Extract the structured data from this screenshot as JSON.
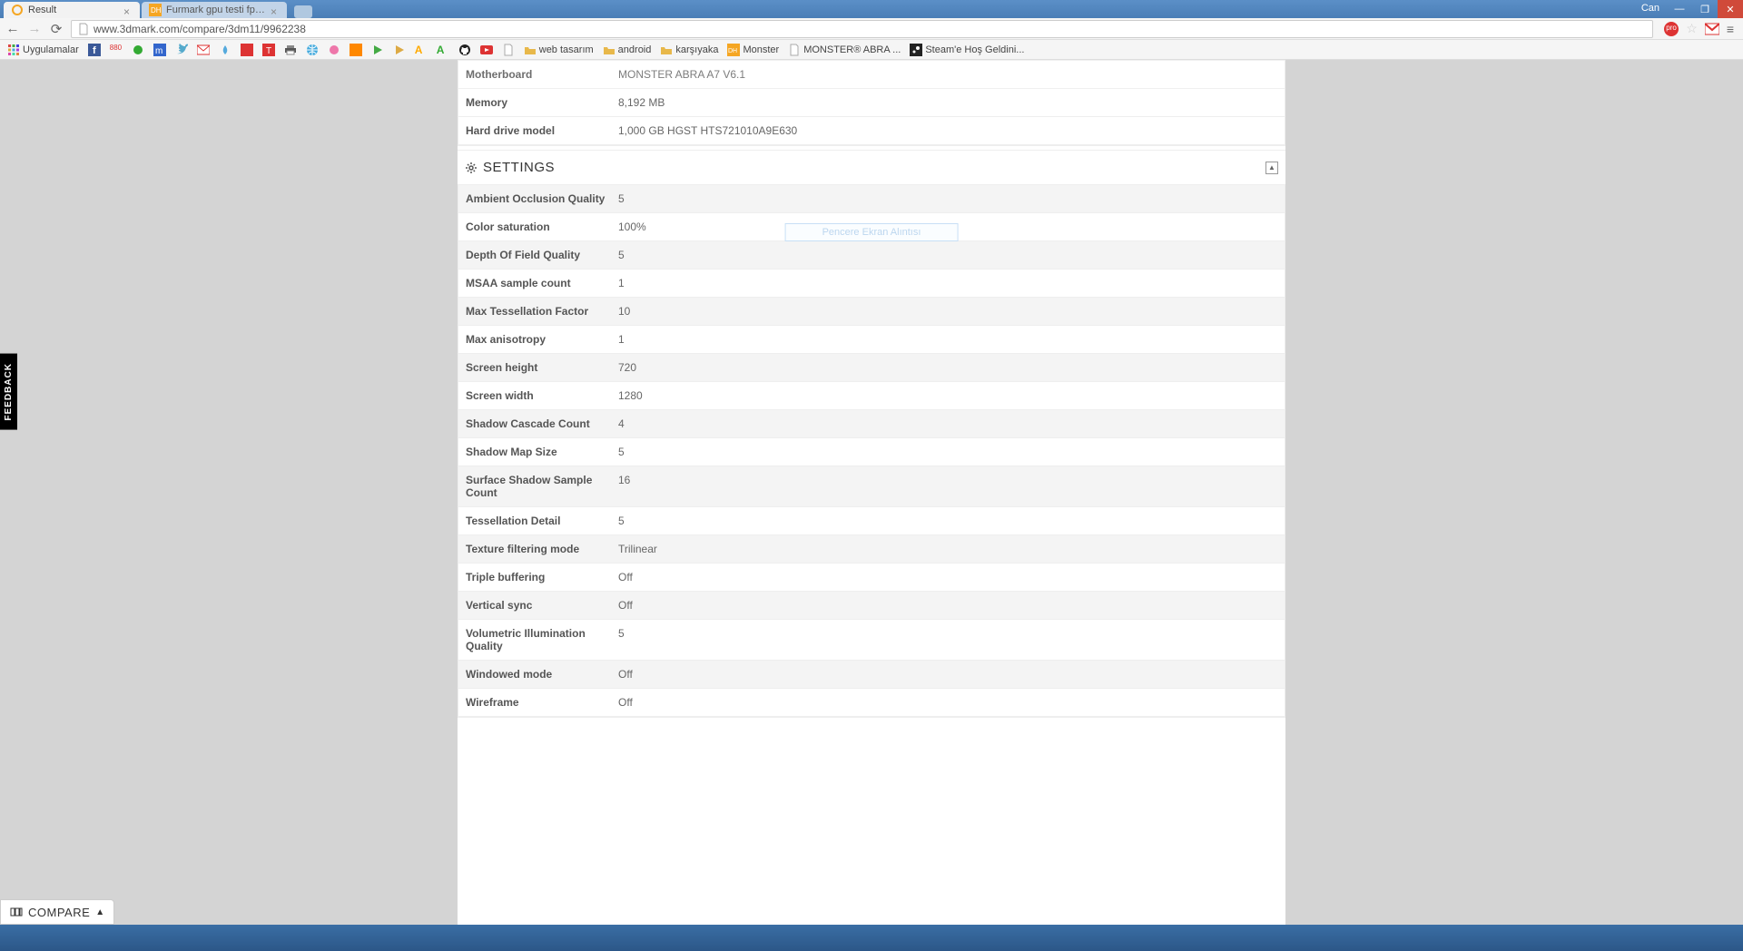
{
  "window": {
    "user": "Can"
  },
  "tabs": [
    {
      "title": "Result",
      "favicon": "orange-circle"
    },
    {
      "title": "Furmark gpu testi fps çok",
      "favicon": "dh-orange"
    }
  ],
  "url": "www.3dmark.com/compare/3dm11/9962238",
  "bookmarks": [
    {
      "label": "Uygulamalar",
      "icon": "apps"
    },
    {
      "label": "",
      "icon": "fb"
    },
    {
      "label": "",
      "icon": "880"
    },
    {
      "label": "",
      "icon": "green-o"
    },
    {
      "label": "",
      "icon": "m-blue"
    },
    {
      "label": "",
      "icon": "twitter"
    },
    {
      "label": "",
      "icon": "gmail"
    },
    {
      "label": "",
      "icon": "blue-drop"
    },
    {
      "label": "",
      "icon": "red-sq"
    },
    {
      "label": "",
      "icon": "red-t"
    },
    {
      "label": "",
      "icon": "print"
    },
    {
      "label": "",
      "icon": "globe"
    },
    {
      "label": "",
      "icon": "pink"
    },
    {
      "label": "",
      "icon": "orange-cal"
    },
    {
      "label": "",
      "icon": "play"
    },
    {
      "label": "",
      "icon": "play-gold"
    },
    {
      "label": "",
      "icon": "a-yellow"
    },
    {
      "label": "",
      "icon": "a-green"
    },
    {
      "label": "",
      "icon": "github"
    },
    {
      "label": "",
      "icon": "youtube"
    },
    {
      "label": "",
      "icon": "file"
    },
    {
      "label": "web tasarım",
      "icon": "folder"
    },
    {
      "label": "android",
      "icon": "folder"
    },
    {
      "label": "karşıyaka",
      "icon": "folder"
    },
    {
      "label": "Monster",
      "icon": "dh"
    },
    {
      "label": "MONSTER® ABRA ...",
      "icon": "file"
    },
    {
      "label": "Steam'e Hoş Geldini...",
      "icon": "steam"
    }
  ],
  "hardware": [
    {
      "label": "Motherboard",
      "value": "MONSTER ABRA A7 V6.1"
    },
    {
      "label": "Memory",
      "value": "8,192 MB"
    },
    {
      "label": "Hard drive model",
      "value": "1,000 GB HGST HTS721010A9E630"
    }
  ],
  "section_title": "SETTINGS",
  "settings": [
    {
      "label": "Ambient Occlusion Quality",
      "value": "5"
    },
    {
      "label": "Color saturation",
      "value": "100%"
    },
    {
      "label": "Depth Of Field Quality",
      "value": "5"
    },
    {
      "label": "MSAA sample count",
      "value": "1"
    },
    {
      "label": "Max Tessellation Factor",
      "value": "10"
    },
    {
      "label": "Max anisotropy",
      "value": "1"
    },
    {
      "label": "Screen height",
      "value": "720"
    },
    {
      "label": "Screen width",
      "value": "1280"
    },
    {
      "label": "Shadow Cascade Count",
      "value": "4"
    },
    {
      "label": "Shadow Map Size",
      "value": "5"
    },
    {
      "label": "Surface Shadow Sample Count",
      "value": "16"
    },
    {
      "label": "Tessellation Detail",
      "value": "5"
    },
    {
      "label": "Texture filtering mode",
      "value": "Trilinear"
    },
    {
      "label": "Triple buffering",
      "value": "Off"
    },
    {
      "label": "Vertical sync",
      "value": "Off"
    },
    {
      "label": "Volumetric Illumination Quality",
      "value": "5"
    },
    {
      "label": "Windowed mode",
      "value": "Off"
    },
    {
      "label": "Wireframe",
      "value": "Off"
    }
  ],
  "ghost_text": "Pencere Ekran Alıntısı",
  "feedback_label": "FEEDBACK",
  "compare_label": "COMPARE"
}
